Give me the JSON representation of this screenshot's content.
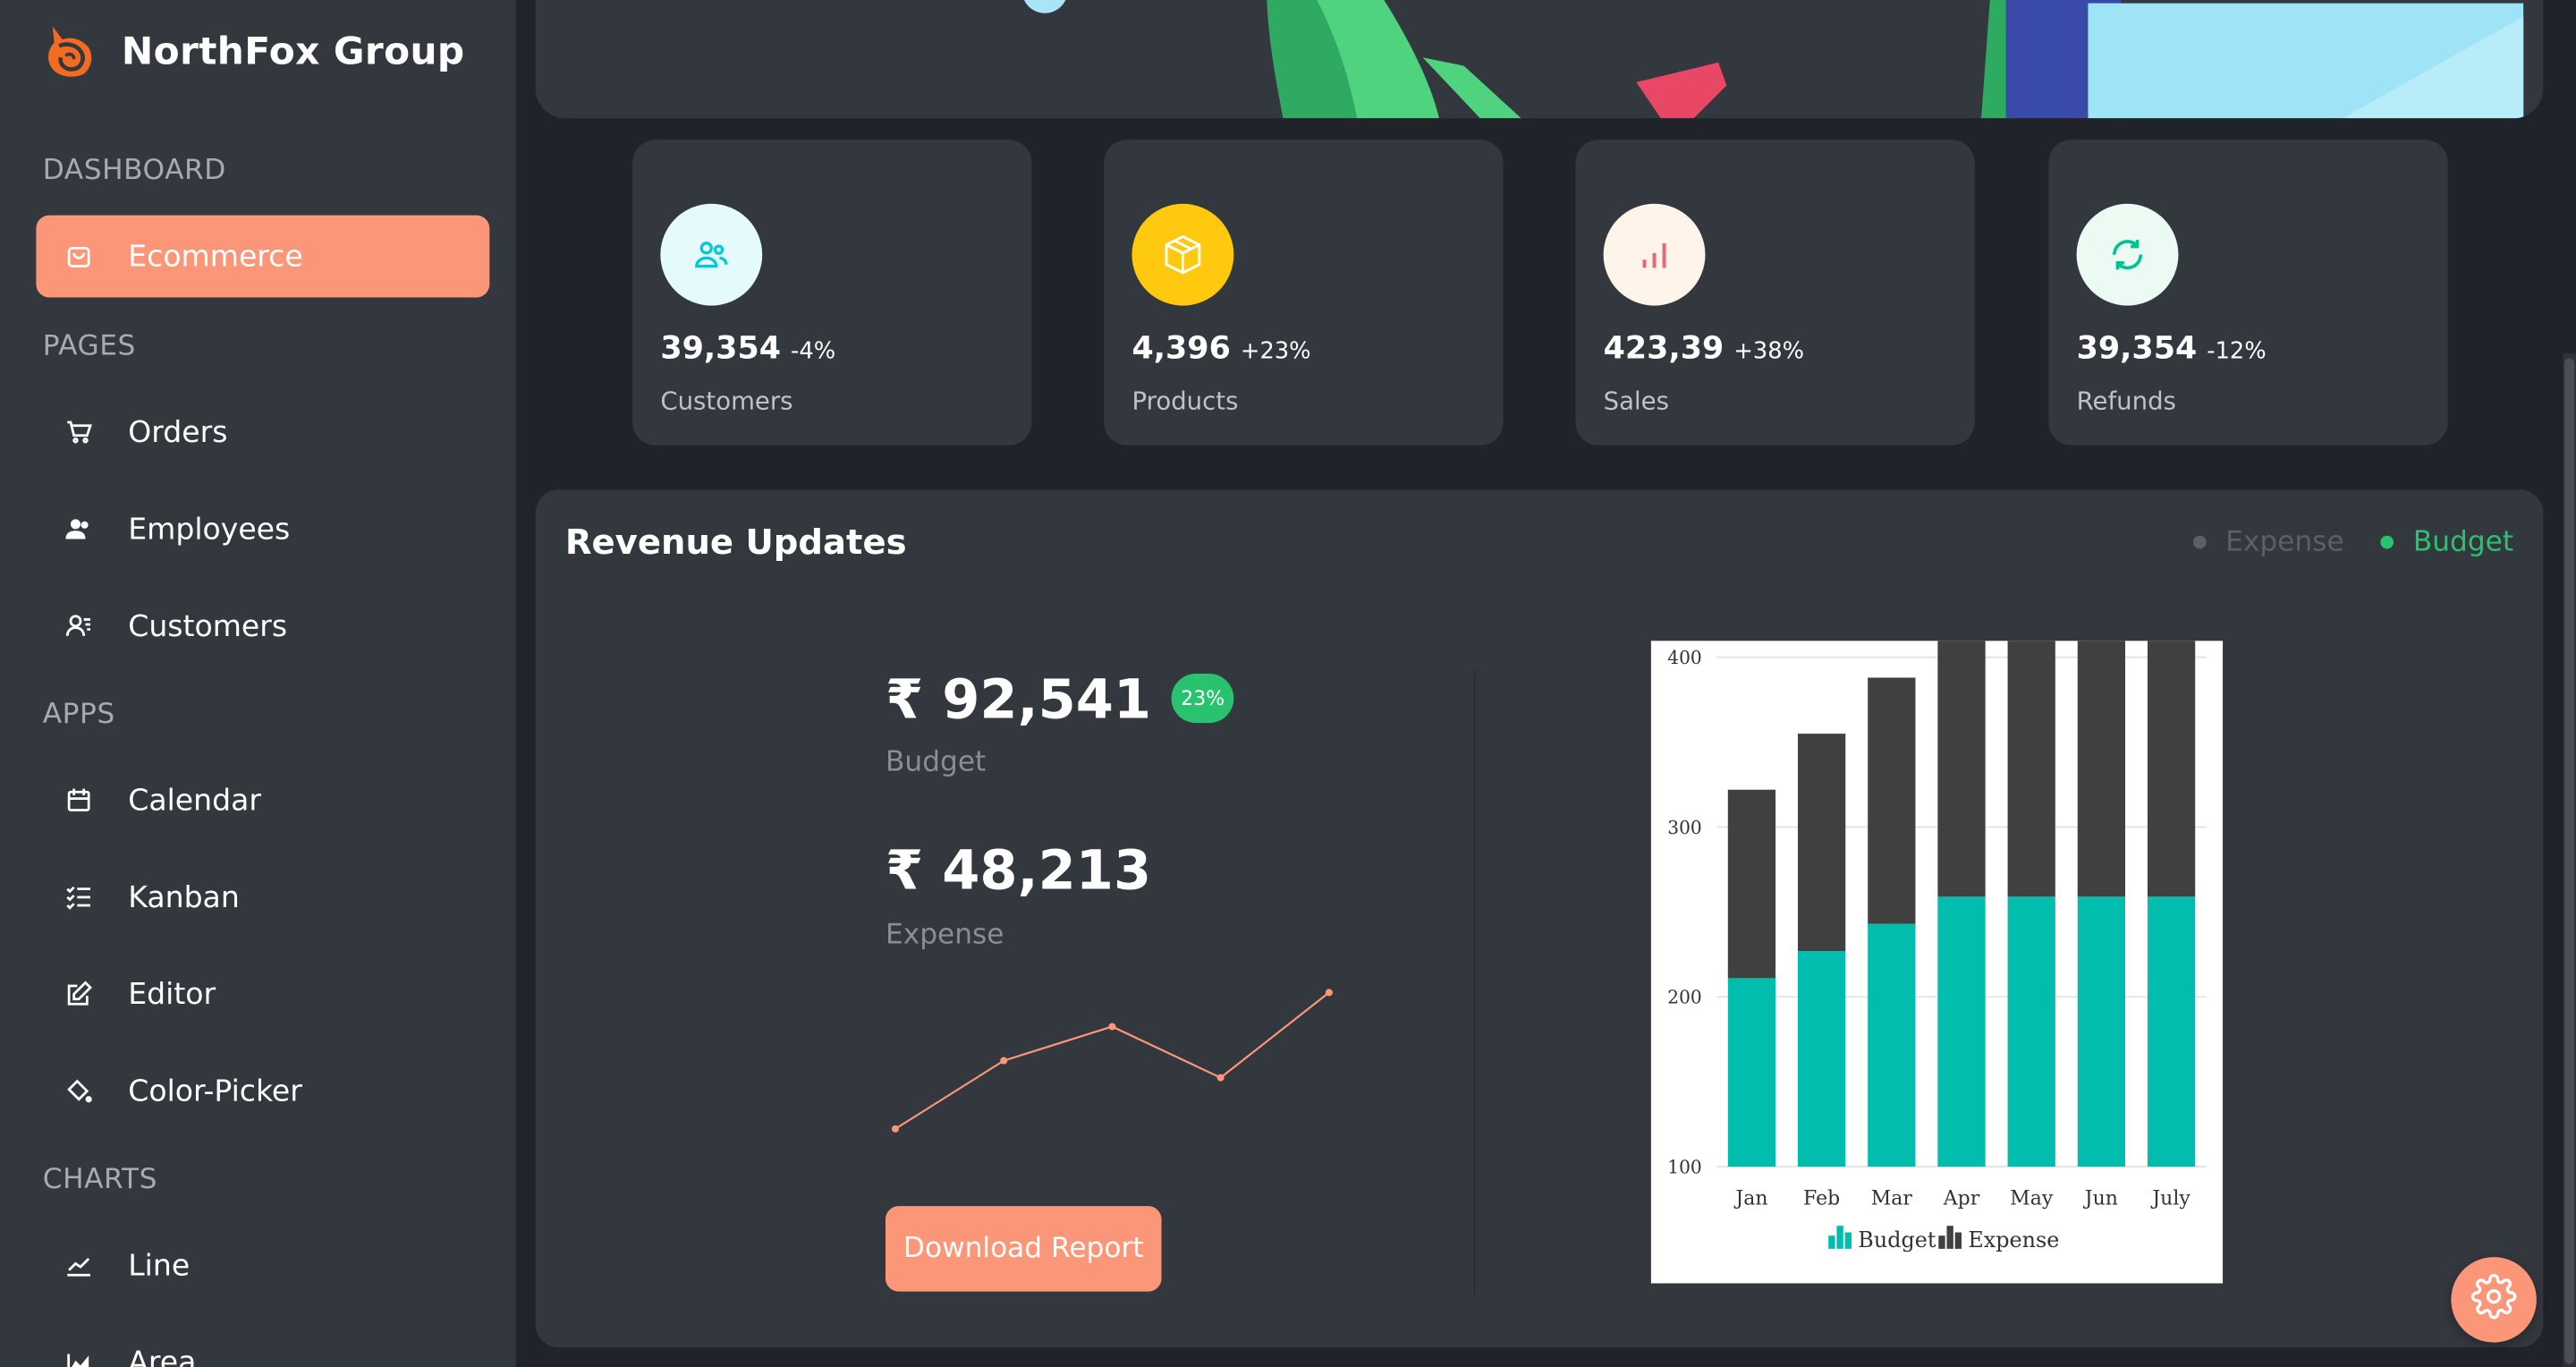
{
  "app": {
    "brand": "NorthFox Group"
  },
  "sidebar": {
    "sections": {
      "dashboard": "DASHBOARD",
      "pages": "PAGES",
      "apps": "APPS",
      "charts": "CHARTS"
    },
    "items": [
      {
        "label": "Ecommerce",
        "icon": "shopping-bag-icon",
        "active": true
      },
      {
        "label": "Orders",
        "icon": "cart-icon"
      },
      {
        "label": "Employees",
        "icon": "users-icon"
      },
      {
        "label": "Customers",
        "icon": "user-list-icon"
      },
      {
        "label": "Calendar",
        "icon": "calendar-icon"
      },
      {
        "label": "Kanban",
        "icon": "checklist-icon"
      },
      {
        "label": "Editor",
        "icon": "edit-icon"
      },
      {
        "label": "Color-Picker",
        "icon": "paint-bucket-icon"
      },
      {
        "label": "Line",
        "icon": "line-chart-icon"
      },
      {
        "label": "Area",
        "icon": "area-chart-icon"
      }
    ],
    "accent": "#fb9678"
  },
  "stats": [
    {
      "value": "39,354",
      "change": "-4%",
      "label": "Customers",
      "icon": "users-icon",
      "icon_color": "#03c9d7",
      "bg": "#e5fafb"
    },
    {
      "value": "4,396",
      "change": "+23%",
      "label": "Products",
      "icon": "box-icon",
      "icon_color": "#ffffff",
      "bg": "#fec90f"
    },
    {
      "value": "423,39",
      "change": "+38%",
      "label": "Sales",
      "icon": "bar-chart-icon",
      "icon_color": "#e46a76",
      "bg": "#fff4ea"
    },
    {
      "value": "39,354",
      "change": "-12%",
      "label": "Refunds",
      "icon": "refresh-icon",
      "icon_color": "#00c292",
      "bg": "#ebfaf2"
    }
  ],
  "revenue": {
    "title": "Revenue Updates",
    "legend": {
      "expense": "Expense",
      "budget": "Budget",
      "expense_color": "#5c5f66",
      "budget_color": "#29c26e"
    },
    "budget_value": "₹ 92,541",
    "budget_badge": "23%",
    "budget_label": "Budget",
    "expense_value": "₹ 48,213",
    "expense_label": "Expense",
    "button": "Download Report"
  },
  "sparkline": {
    "values": [
      1,
      3,
      4,
      2.5,
      5
    ],
    "color": "#fb9678"
  },
  "chart_data": {
    "type": "bar",
    "stacked": true,
    "categories": [
      "Jan",
      "Feb",
      "Mar",
      "Apr",
      "May",
      "Jun",
      "July"
    ],
    "series": [
      {
        "name": "Budget",
        "values": [
          111,
          127,
          143,
          159,
          159,
          159,
          159
        ],
        "color": "#00bdae"
      },
      {
        "name": "Expense",
        "values": [
          111,
          128,
          145,
          161,
          161,
          161,
          161
        ],
        "color": "#404041"
      }
    ],
    "ylim": [
      100,
      400
    ],
    "yticks": [
      "100",
      "200",
      "300",
      "400"
    ],
    "grid": true,
    "legend_position": "bottom"
  },
  "settings": {
    "icon": "gear-icon"
  }
}
